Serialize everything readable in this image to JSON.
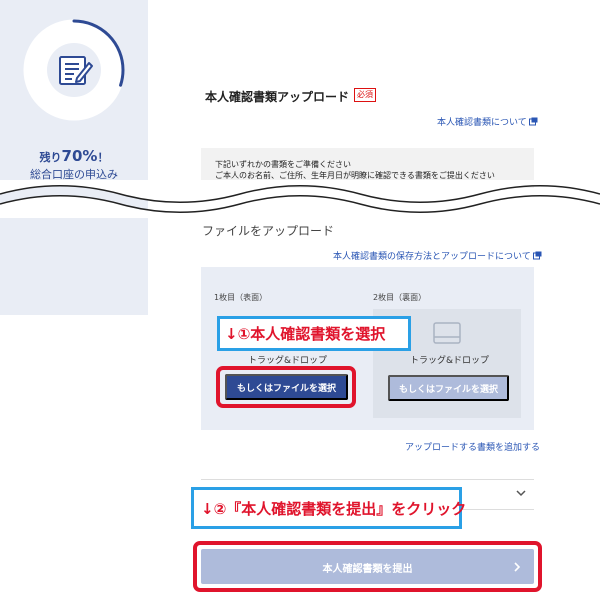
{
  "sidebar": {
    "progress_percent": 70,
    "progress_prefix": "残り",
    "progress_value": "70%",
    "progress_suffix": "！",
    "subtitle": "総合口座の申込み",
    "icon": "document-pen-icon"
  },
  "section": {
    "title": "本人確認書類アップロード",
    "required_badge": "必須",
    "about_link": "本人確認書類について"
  },
  "notice": {
    "line1": "下記いずれかの書類をご準備ください",
    "line2": "ご本人のお名前、ご住所、生年月日が明瞭に確認できる書類をご提出ください"
  },
  "upload": {
    "title": "ファイルをアップロード",
    "help_link": "本人確認書類の保存方法とアップロードについて",
    "front_label": "1枚目（表面）",
    "back_label": "2枚目（裏面）",
    "drag_drop": "トラッグ&ドロップ",
    "drag_drop_back": "トラッグ&ドロップ",
    "select_front": "もしくはファイルを選択",
    "select_back": "もしくはファイルを選択",
    "add_link": "アップロードする書類を追加する"
  },
  "callouts": {
    "step1": "↓①本人確認書類を選択",
    "step2": "↓②『本人確認書類を提出』をクリック"
  },
  "submit": {
    "label": "本人確認書類を提出"
  },
  "colors": {
    "brand": "#2e4a94",
    "disabled": "#aebbdb",
    "link": "#2a56b4",
    "highlight": "#e0142c",
    "callout_border": "#2aa0e6",
    "sidebar_bg": "#e9edf5"
  }
}
